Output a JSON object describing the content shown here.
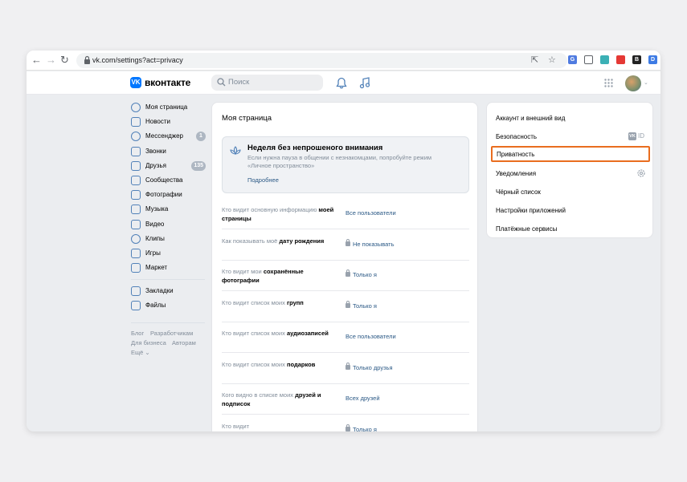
{
  "browser": {
    "url": "vk.com/settings?act=privacy",
    "icons": [
      "back-arrow-icon",
      "forward-arrow-icon",
      "reload-icon",
      "share-icon",
      "star-icon"
    ],
    "extensions": [
      {
        "name": "translate-extension-icon",
        "color": "#4f7be0",
        "glyph": "G"
      },
      {
        "name": "wrench-extension-icon",
        "color": "#ffffff",
        "glyph": ""
      },
      {
        "name": "puzzle-extension-icon",
        "color": "#3bb0b5",
        "glyph": ""
      },
      {
        "name": "pokeball-extension-icon",
        "color": "#e53935",
        "glyph": ""
      },
      {
        "name": "bold-extension-icon",
        "color": "#222222",
        "glyph": "B"
      },
      {
        "name": "doc-extension-icon",
        "color": "#3d7be4",
        "glyph": "D"
      }
    ]
  },
  "header": {
    "logo_glyph": "VK",
    "brand": "вконтакте",
    "search_placeholder": "Поиск"
  },
  "leftmenu": {
    "items": [
      {
        "label": "Моя страница",
        "icon": "user-circle-icon"
      },
      {
        "label": "Новости",
        "icon": "news-icon"
      },
      {
        "label": "Мессенджер",
        "icon": "message-icon",
        "badge": "1"
      },
      {
        "label": "Звонки",
        "icon": "phone-icon"
      },
      {
        "label": "Друзья",
        "icon": "friends-icon",
        "badge": "135"
      },
      {
        "label": "Сообщества",
        "icon": "communities-icon"
      },
      {
        "label": "Фотографии",
        "icon": "photos-icon"
      },
      {
        "label": "Музыка",
        "icon": "music-icon"
      },
      {
        "label": "Видео",
        "icon": "video-icon"
      },
      {
        "label": "Клипы",
        "icon": "clips-icon"
      },
      {
        "label": "Игры",
        "icon": "games-icon"
      },
      {
        "label": "Маркет",
        "icon": "market-icon"
      }
    ],
    "items2": [
      {
        "label": "Закладки",
        "icon": "bookmarks-icon"
      },
      {
        "label": "Файлы",
        "icon": "files-icon"
      }
    ],
    "footer": {
      "blog": "Блог",
      "developers": "Разработчикам",
      "business": "Для бизнеса",
      "authors": "Авторам",
      "more": "Ещё ⌄"
    }
  },
  "center": {
    "title": "Моя страница",
    "banner": {
      "title": "Неделя без непрошеного внимания",
      "text": "Если нужна пауза в общении с незнакомцами, попробуйте режим «Личное пространство»",
      "link": "Подробнее"
    },
    "rows": [
      {
        "label_pre": "Кто видит основную информацию ",
        "label_bold": "моей страницы",
        "value": "Все пользователи",
        "locked": false
      },
      {
        "label_pre": "Как показывать моё ",
        "label_bold": "дату рождения",
        "value": "Не показывать",
        "locked": true
      },
      {
        "label_pre": "Кто видит мои ",
        "label_bold": "сохранённые фотографии",
        "value": "Только я",
        "locked": true
      },
      {
        "label_pre": "Кто видит список моих ",
        "label_bold": "групп",
        "value": "Только я",
        "locked": true
      },
      {
        "label_pre": "Кто видит список моих ",
        "label_bold": "аудиозаписей",
        "value": "Все пользователи",
        "locked": false
      },
      {
        "label_pre": "Кто видит список моих ",
        "label_bold": "подарков",
        "value": "Только друзья",
        "locked": true
      },
      {
        "label_pre": "Кого видно в списке моих ",
        "label_bold": "друзей и подписок",
        "value": "Всех друзей",
        "locked": false
      },
      {
        "label_pre": "Кто видит ",
        "label_bold": "",
        "value": "Только я",
        "locked": true
      }
    ]
  },
  "right": {
    "items": [
      {
        "label": "Аккаунт и внешний вид"
      },
      {
        "label": "Безопасность",
        "extra": "ID",
        "extra_box": "VK"
      },
      {
        "label": "Приватность",
        "active": true
      },
      {
        "label": "Уведомления",
        "gear": true
      },
      {
        "label": "Чёрный список"
      },
      {
        "label": "Настройки приложений"
      },
      {
        "label": "Платёжные сервисы"
      }
    ],
    "highlight_color": "#e96d1f"
  }
}
